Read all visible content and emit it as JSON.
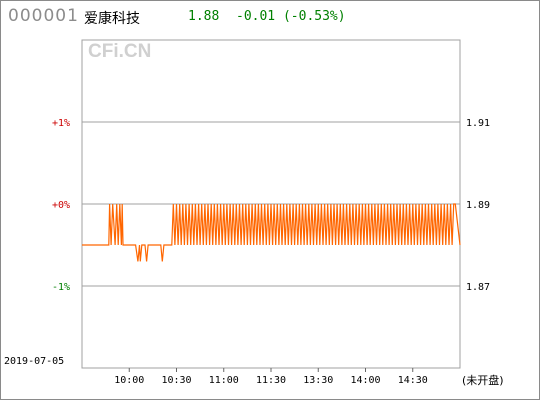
{
  "header": {
    "stock_code": "000001",
    "stock_name": "爱康科技",
    "price": "1.88",
    "change": "-0.01 (-0.53%)"
  },
  "watermark": "CFi.CN",
  "date": "2019-07-05",
  "market_status": "(未开盘)",
  "colors": {
    "price_line": "#ff6600",
    "up": "#cc0000",
    "down": "#008000",
    "zero": "#cc0000",
    "grid": "#a0a0a0",
    "watermark": "#d0d0d0"
  },
  "chart_data": {
    "type": "line",
    "title": "",
    "xlabel": "",
    "ylabel": "",
    "left_ticks": [
      {
        "label": "+1%",
        "value": 1.91,
        "color": "up"
      },
      {
        "label": "+0%",
        "value": 1.89,
        "color": "zero"
      },
      {
        "label": "-1%",
        "value": 1.87,
        "color": "down"
      }
    ],
    "right_ticks": [
      {
        "label": "1.91",
        "value": 1.91
      },
      {
        "label": "1.89",
        "value": 1.89
      },
      {
        "label": "1.87",
        "value": 1.87
      }
    ],
    "x_ticks": [
      "10:00",
      "10:30",
      "11:00",
      "11:30",
      "13:30",
      "14:00",
      "14:30"
    ],
    "ylim": [
      1.85,
      1.93
    ],
    "x_range_minutes": [
      0,
      240
    ],
    "series": [
      {
        "values": [
          [
            0,
            1.88
          ],
          [
            17,
            1.88
          ],
          [
            17.5,
            1.89
          ],
          [
            18.5,
            1.88
          ],
          [
            19.5,
            1.89
          ],
          [
            21,
            1.88
          ],
          [
            22,
            1.89
          ],
          [
            23,
            1.88
          ],
          [
            24,
            1.89
          ],
          [
            25,
            1.88
          ],
          [
            25.5,
            1.89
          ],
          [
            26,
            1.88
          ],
          [
            34,
            1.88
          ],
          [
            35.5,
            1.876
          ],
          [
            36.5,
            1.88
          ],
          [
            37,
            1.876
          ],
          [
            38,
            1.88
          ],
          [
            40,
            1.88
          ],
          [
            41,
            1.876
          ],
          [
            42,
            1.88
          ],
          [
            50,
            1.88
          ],
          [
            51,
            1.876
          ],
          [
            52,
            1.88
          ],
          [
            57,
            1.88
          ],
          [
            58,
            1.89
          ],
          [
            59,
            1.88
          ],
          [
            60,
            1.89
          ],
          [
            61,
            1.88
          ],
          [
            62,
            1.89
          ],
          [
            63,
            1.88
          ],
          [
            64,
            1.89
          ],
          [
            65,
            1.88
          ],
          [
            66,
            1.89
          ],
          [
            67,
            1.88
          ],
          [
            68,
            1.89
          ],
          [
            69,
            1.88
          ],
          [
            70,
            1.89
          ],
          [
            71,
            1.88
          ],
          [
            72,
            1.89
          ],
          [
            73,
            1.88
          ],
          [
            74,
            1.89
          ],
          [
            75,
            1.88
          ],
          [
            76,
            1.89
          ],
          [
            77,
            1.88
          ],
          [
            78,
            1.89
          ],
          [
            79,
            1.88
          ],
          [
            80,
            1.89
          ],
          [
            81,
            1.88
          ],
          [
            82,
            1.89
          ],
          [
            83,
            1.88
          ],
          [
            84,
            1.89
          ],
          [
            85,
            1.88
          ],
          [
            86,
            1.89
          ],
          [
            87,
            1.88
          ],
          [
            88,
            1.89
          ],
          [
            89,
            1.88
          ],
          [
            90,
            1.89
          ],
          [
            91,
            1.88
          ],
          [
            92,
            1.89
          ],
          [
            93,
            1.88
          ],
          [
            94,
            1.89
          ],
          [
            95,
            1.88
          ],
          [
            96,
            1.89
          ],
          [
            97,
            1.88
          ],
          [
            98,
            1.89
          ],
          [
            99,
            1.88
          ],
          [
            100,
            1.89
          ],
          [
            101,
            1.88
          ],
          [
            102,
            1.89
          ],
          [
            103,
            1.88
          ],
          [
            104,
            1.89
          ],
          [
            105,
            1.88
          ],
          [
            106,
            1.89
          ],
          [
            107,
            1.88
          ],
          [
            108,
            1.89
          ],
          [
            109,
            1.88
          ],
          [
            110,
            1.89
          ],
          [
            111,
            1.88
          ],
          [
            112,
            1.89
          ],
          [
            113,
            1.88
          ],
          [
            114,
            1.89
          ],
          [
            115,
            1.88
          ],
          [
            116,
            1.89
          ],
          [
            117,
            1.88
          ],
          [
            118,
            1.89
          ],
          [
            119,
            1.88
          ],
          [
            120,
            1.89
          ],
          [
            121,
            1.88
          ],
          [
            122,
            1.89
          ],
          [
            123,
            1.88
          ],
          [
            124,
            1.89
          ],
          [
            125,
            1.88
          ],
          [
            126,
            1.89
          ],
          [
            127,
            1.88
          ],
          [
            128,
            1.89
          ],
          [
            129,
            1.88
          ],
          [
            130,
            1.89
          ],
          [
            131,
            1.88
          ],
          [
            132,
            1.89
          ],
          [
            133,
            1.88
          ],
          [
            134,
            1.89
          ],
          [
            135,
            1.88
          ],
          [
            136,
            1.89
          ],
          [
            137,
            1.88
          ],
          [
            138,
            1.89
          ],
          [
            139,
            1.88
          ],
          [
            140,
            1.89
          ],
          [
            141,
            1.88
          ],
          [
            142,
            1.89
          ],
          [
            143,
            1.88
          ],
          [
            144,
            1.89
          ],
          [
            145,
            1.88
          ],
          [
            146,
            1.89
          ],
          [
            147,
            1.88
          ],
          [
            148,
            1.89
          ],
          [
            149,
            1.88
          ],
          [
            150,
            1.89
          ],
          [
            151,
            1.88
          ],
          [
            152,
            1.89
          ],
          [
            153,
            1.88
          ],
          [
            154,
            1.89
          ],
          [
            155,
            1.88
          ],
          [
            156,
            1.89
          ],
          [
            157,
            1.88
          ],
          [
            158,
            1.89
          ],
          [
            159,
            1.88
          ],
          [
            160,
            1.89
          ],
          [
            161,
            1.88
          ],
          [
            162,
            1.89
          ],
          [
            163,
            1.88
          ],
          [
            164,
            1.89
          ],
          [
            165,
            1.88
          ],
          [
            166,
            1.89
          ],
          [
            167,
            1.88
          ],
          [
            168,
            1.89
          ],
          [
            169,
            1.88
          ],
          [
            170,
            1.89
          ],
          [
            171,
            1.88
          ],
          [
            172,
            1.89
          ],
          [
            173,
            1.88
          ],
          [
            174,
            1.89
          ],
          [
            175,
            1.88
          ],
          [
            176,
            1.89
          ],
          [
            177,
            1.88
          ],
          [
            178,
            1.89
          ],
          [
            179,
            1.88
          ],
          [
            180,
            1.89
          ],
          [
            181,
            1.88
          ],
          [
            182,
            1.89
          ],
          [
            183,
            1.88
          ],
          [
            184,
            1.89
          ],
          [
            185,
            1.88
          ],
          [
            186,
            1.89
          ],
          [
            187,
            1.88
          ],
          [
            188,
            1.89
          ],
          [
            189,
            1.88
          ],
          [
            190,
            1.89
          ],
          [
            191,
            1.88
          ],
          [
            192,
            1.89
          ],
          [
            193,
            1.88
          ],
          [
            194,
            1.89
          ],
          [
            195,
            1.88
          ],
          [
            196,
            1.89
          ],
          [
            197,
            1.88
          ],
          [
            198,
            1.89
          ],
          [
            199,
            1.88
          ],
          [
            200,
            1.89
          ],
          [
            201,
            1.88
          ],
          [
            202,
            1.89
          ],
          [
            203,
            1.88
          ],
          [
            204,
            1.89
          ],
          [
            205,
            1.88
          ],
          [
            206,
            1.89
          ],
          [
            207,
            1.88
          ],
          [
            208,
            1.89
          ],
          [
            209,
            1.88
          ],
          [
            210,
            1.89
          ],
          [
            211,
            1.88
          ],
          [
            212,
            1.89
          ],
          [
            213,
            1.88
          ],
          [
            214,
            1.89
          ],
          [
            215,
            1.88
          ],
          [
            216,
            1.89
          ],
          [
            217,
            1.88
          ],
          [
            218,
            1.89
          ],
          [
            219,
            1.88
          ],
          [
            220,
            1.89
          ],
          [
            221,
            1.88
          ],
          [
            222,
            1.89
          ],
          [
            223,
            1.88
          ],
          [
            224,
            1.89
          ],
          [
            225,
            1.88
          ],
          [
            226,
            1.89
          ],
          [
            227,
            1.88
          ],
          [
            228,
            1.89
          ],
          [
            229,
            1.88
          ],
          [
            230,
            1.89
          ],
          [
            231,
            1.88
          ],
          [
            232,
            1.89
          ],
          [
            233,
            1.88
          ],
          [
            234,
            1.89
          ],
          [
            235,
            1.88
          ],
          [
            236,
            1.89
          ],
          [
            237,
            1.89
          ],
          [
            240,
            1.88
          ]
        ]
      }
    ],
    "grid": true
  }
}
